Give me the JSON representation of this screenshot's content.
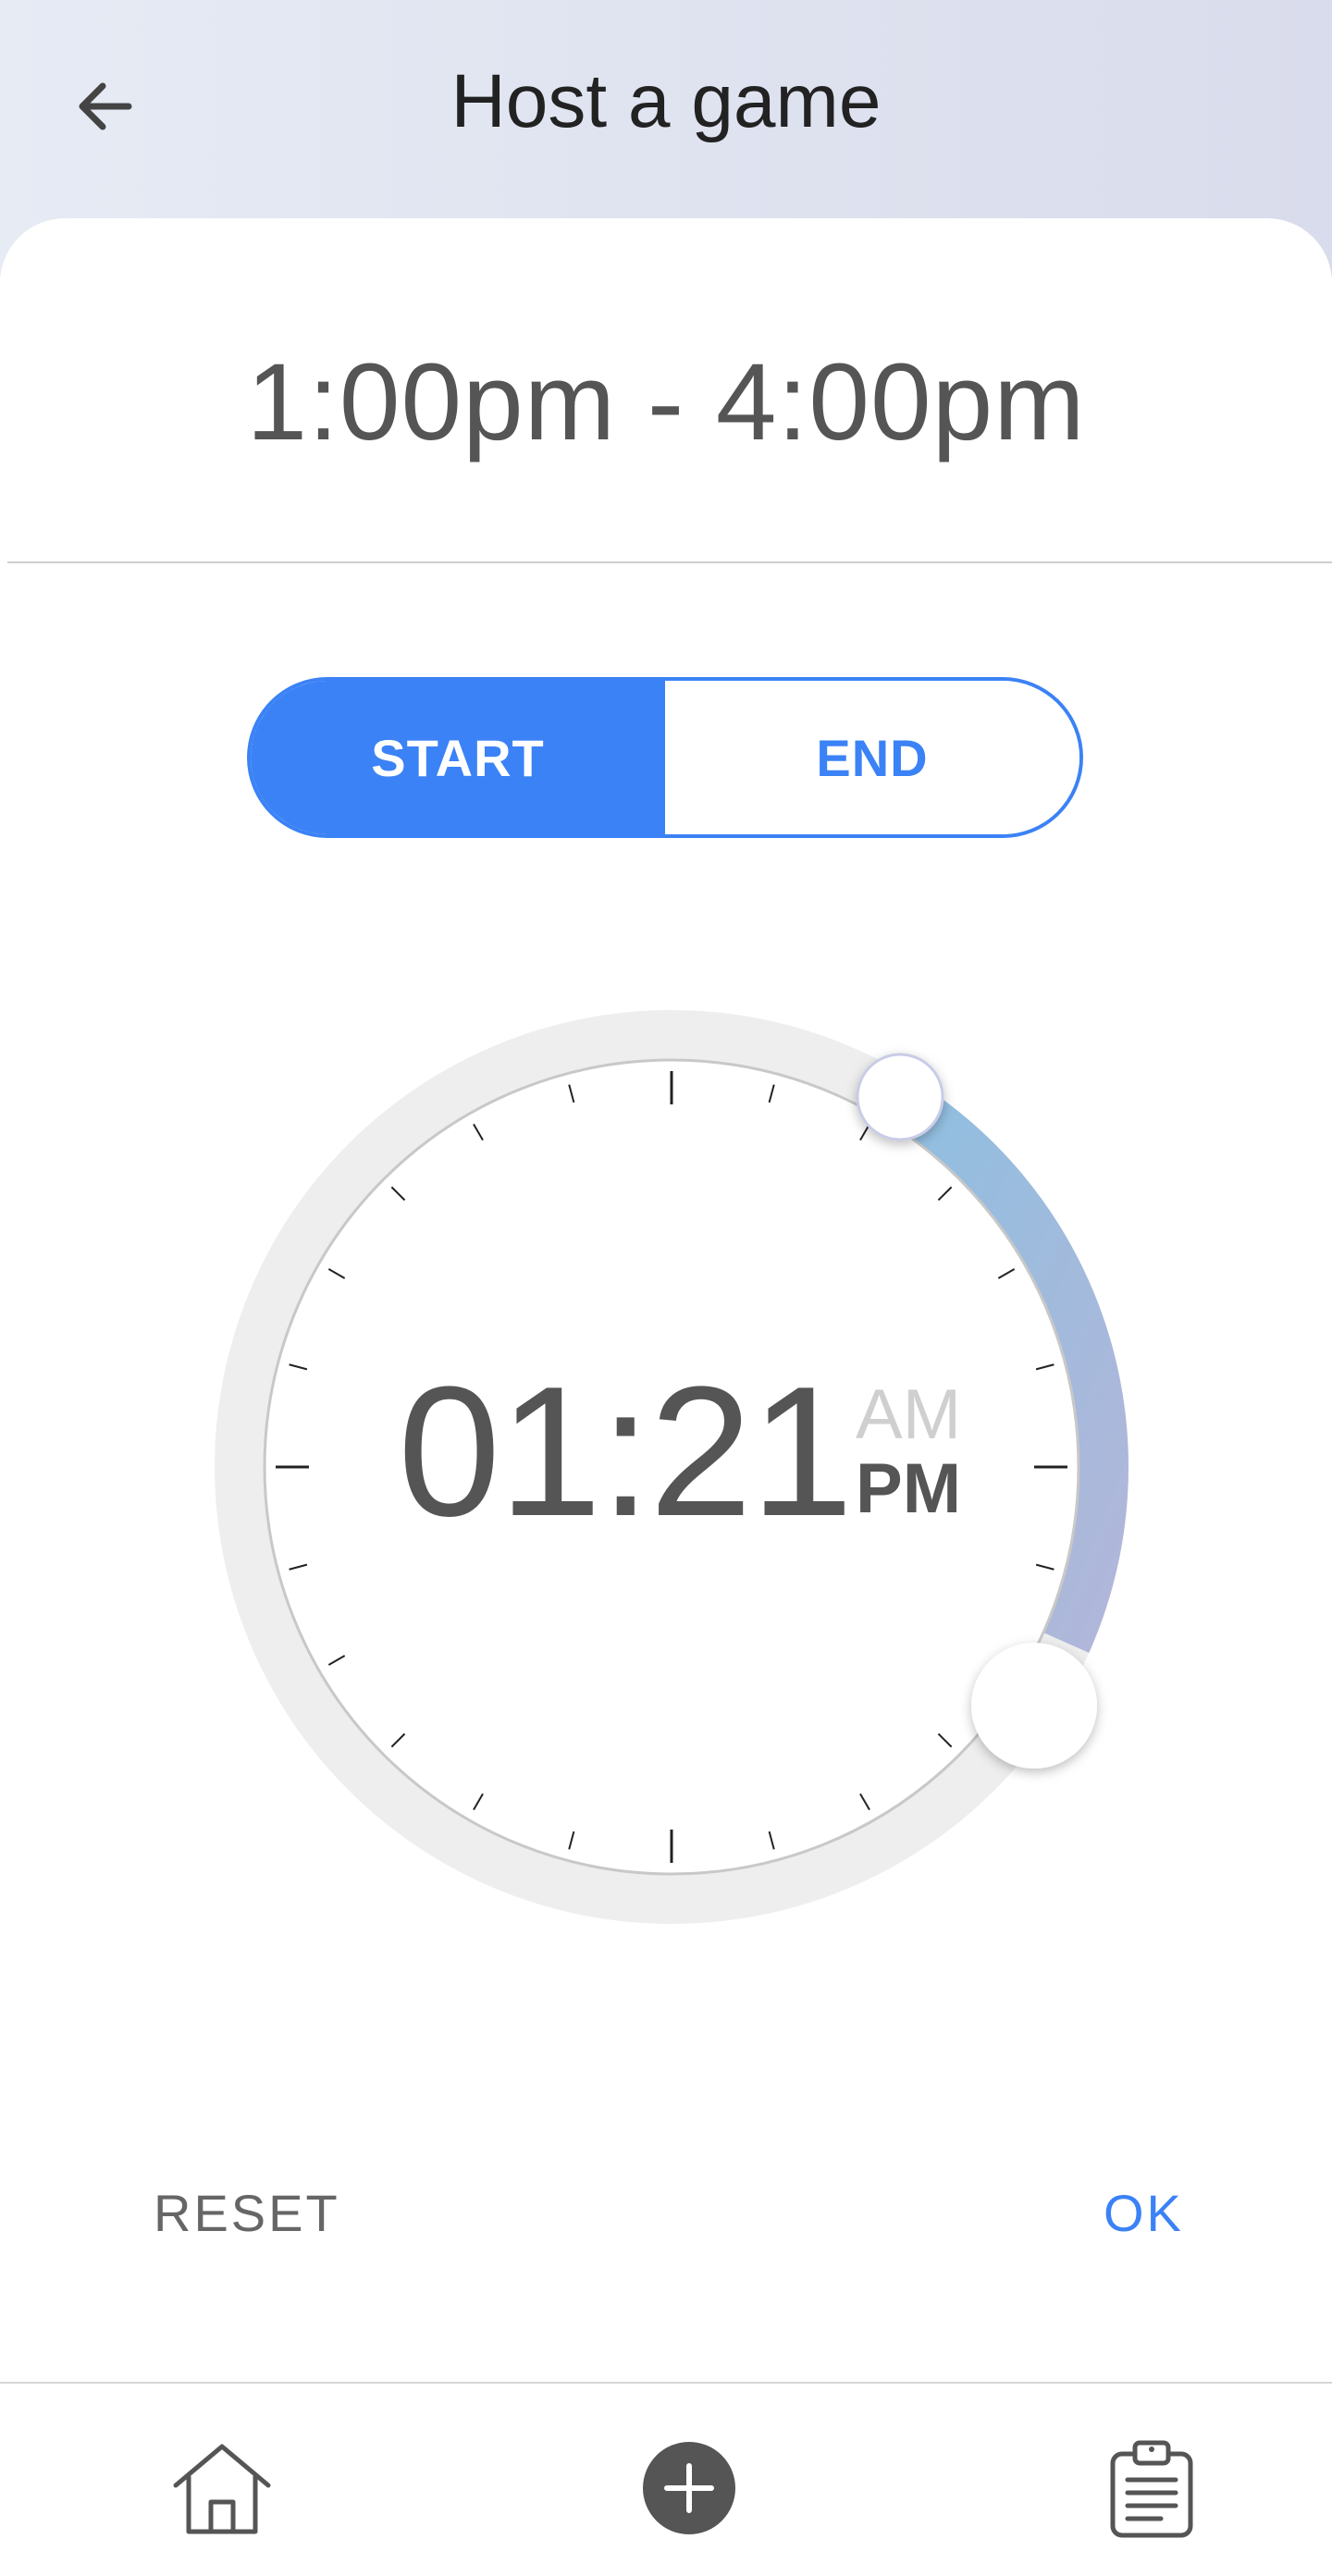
{
  "header": {
    "title": "Host a game",
    "back_icon": "arrow-left-icon"
  },
  "time_range": "1:00pm - 4:00pm",
  "toggle": {
    "start_label": "START",
    "end_label": "END",
    "active": "start"
  },
  "dial": {
    "time": "01:21",
    "am_label": "AM",
    "pm_label": "PM",
    "active_period": "PM",
    "colors": {
      "track": "#eeeeee",
      "arc_start": "#8ebfe0",
      "arc_end": "#b3b6d9",
      "tick": "#222222"
    }
  },
  "actions": {
    "reset_label": "RESET",
    "ok_label": "OK"
  },
  "bottom_nav": {
    "items": [
      {
        "icon": "home-icon"
      },
      {
        "icon": "add-icon"
      },
      {
        "icon": "clipboard-icon"
      }
    ]
  },
  "colors": {
    "accent": "#3b82f6",
    "header_gradient": [
      "#e6ebf4",
      "#d9dcec"
    ]
  }
}
